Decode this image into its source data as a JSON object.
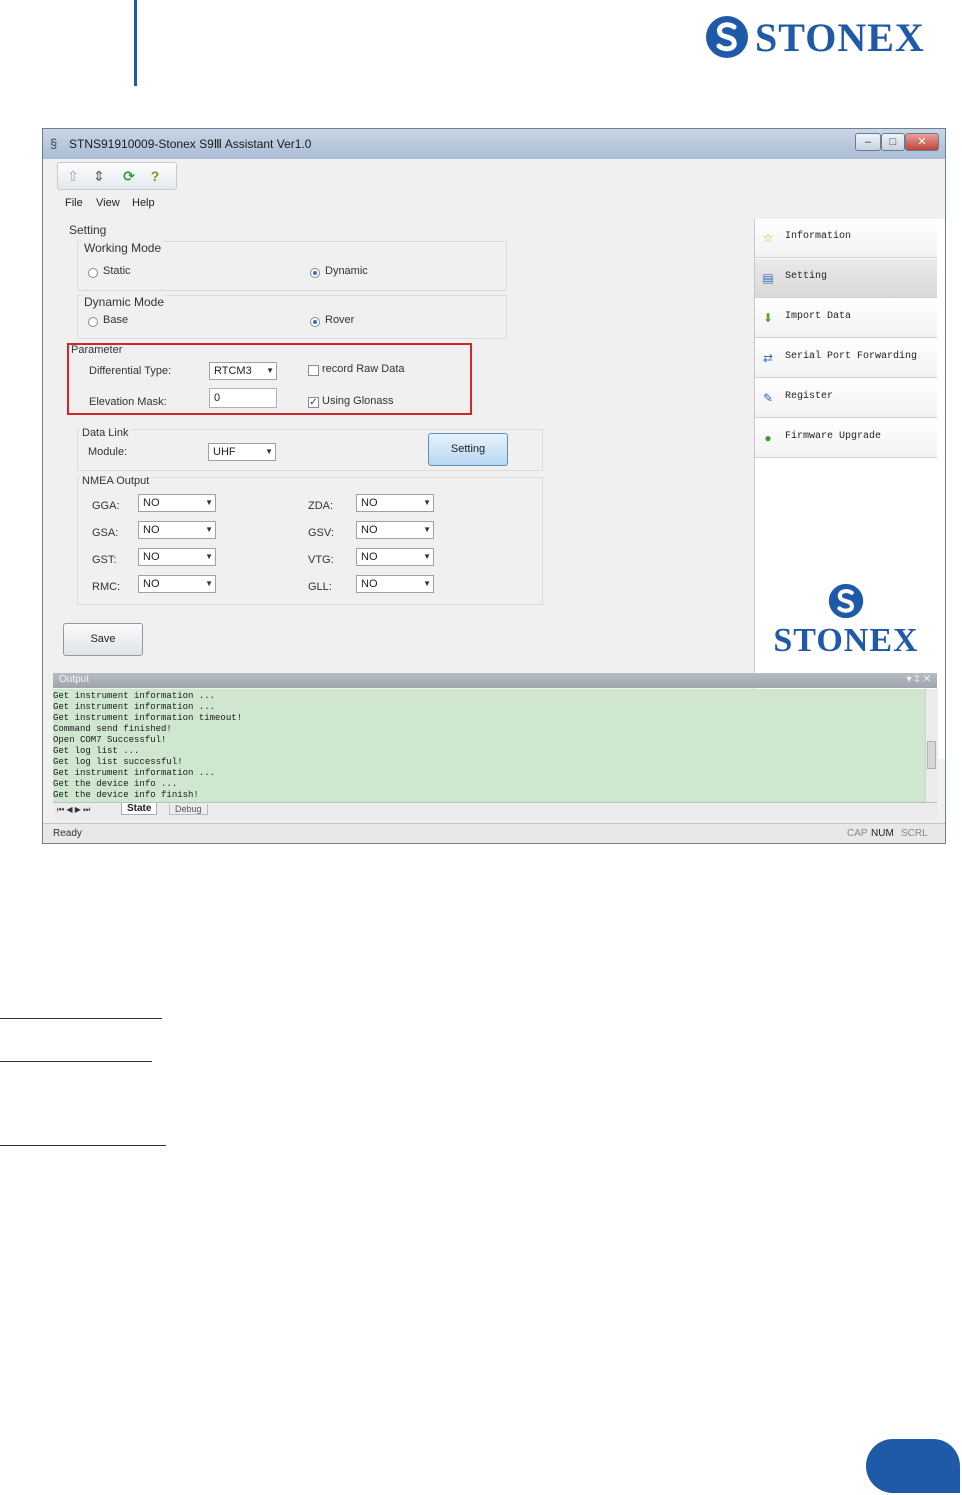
{
  "page": {
    "brand": "STONEX"
  },
  "window": {
    "title": "STNS91910009-Stonex S9Ⅲ Assistant Ver1.0",
    "controls": [
      "–",
      "□",
      "✕"
    ],
    "menu": [
      "File",
      "View",
      "Help"
    ],
    "toolbar_icons": [
      "connect-icon",
      "disconnect-icon",
      "refresh-icon",
      "help-icon"
    ]
  },
  "setting": {
    "title": "Setting",
    "working_mode": {
      "label": "Working Mode",
      "options": [
        "Static",
        "Dynamic"
      ],
      "selected": "Dynamic"
    },
    "dynamic_mode": {
      "label": "Dynamic Mode",
      "options": [
        "Base",
        "Rover"
      ],
      "selected": "Rover"
    },
    "parameter": {
      "label": "Parameter",
      "differential_type_label": "Differential Type:",
      "differential_type_value": "RTCM3",
      "record_raw_label": "record Raw Data",
      "record_raw_checked": false,
      "elevation_mask_label": "Elevation Mask:",
      "elevation_mask_value": "0",
      "glonass_label": "Using Glonass",
      "glonass_checked": true
    },
    "data_link": {
      "label": "Data Link",
      "module_label": "Module:",
      "module_value": "UHF",
      "setting_button": "Setting"
    },
    "nmea": {
      "label": "NMEA Output",
      "left": [
        {
          "name": "GGA:",
          "value": "NO"
        },
        {
          "name": "GSA:",
          "value": "NO"
        },
        {
          "name": "GST:",
          "value": "NO"
        },
        {
          "name": "RMC:",
          "value": "NO"
        }
      ],
      "right": [
        {
          "name": "ZDA:",
          "value": "NO"
        },
        {
          "name": "GSV:",
          "value": "NO"
        },
        {
          "name": "VTG:",
          "value": "NO"
        },
        {
          "name": "GLL:",
          "value": "NO"
        }
      ]
    },
    "save_button": "Save"
  },
  "sidebar": {
    "items": [
      {
        "label": "Information",
        "icon": "star-icon"
      },
      {
        "label": "Setting",
        "icon": "settings-icon"
      },
      {
        "label": "Import Data",
        "icon": "import-icon"
      },
      {
        "label": "Serial Port Forwarding",
        "icon": "serial-port-icon"
      },
      {
        "label": "Register",
        "icon": "register-icon"
      },
      {
        "label": "Firmware Upgrade",
        "icon": "firmware-icon"
      }
    ],
    "selected": "Setting",
    "logo": "STONEX"
  },
  "output": {
    "title": "Output",
    "header_controls": "▾ ‡ ✕",
    "lines": [
      "Get instrument information ...",
      "Get instrument information ...",
      "Get instrument information timeout!",
      "Command send finished!",
      "Open COM7 Successful!",
      "Get log list ...",
      "Get log list successful!",
      "Get instrument information ...",
      "Get the device info ...",
      "Get the device info finish!"
    ],
    "tabs": [
      "State",
      "Debug"
    ],
    "nav": "⏮ ◀ ▶ ⏭"
  },
  "status": {
    "text": "Ready",
    "indicators": [
      "CAP",
      "NUM",
      "SCRL"
    ]
  },
  "colors": {
    "brand_blue": "#1f5aa8",
    "highlight_red": "#d3242a",
    "output_bg": "#cfe6cf"
  }
}
